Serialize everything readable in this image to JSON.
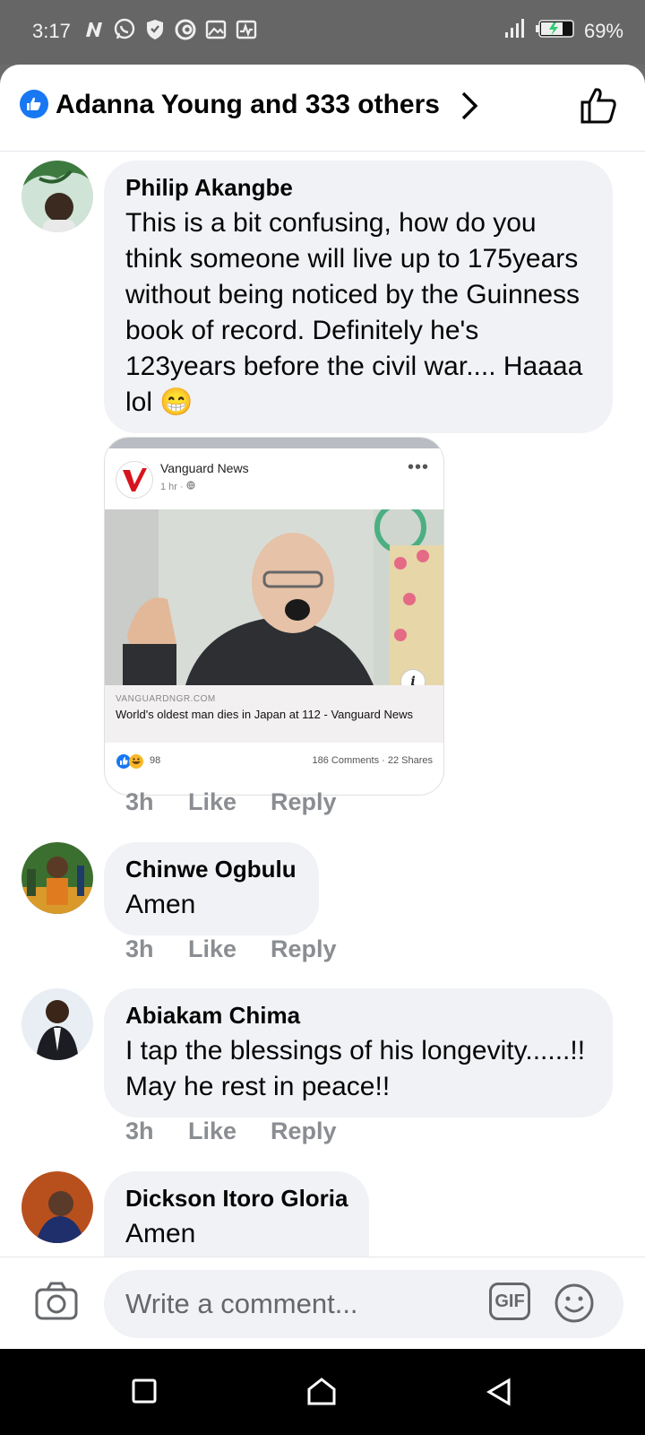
{
  "status_bar": {
    "time": "3:17",
    "battery_percent": "69%",
    "notification_icons": [
      "n-icon",
      "whatsapp-icon",
      "shield-icon",
      "opera-icon",
      "gallery-icon",
      "activity-icon"
    ]
  },
  "header": {
    "reactors_text": "Adanna Young and 333 others"
  },
  "comments": [
    {
      "author": "Philip Akangbe",
      "text": "This is a bit confusing, how do you think someone will live up to 175years without being noticed by the Guinness book of record. Definitely he's 123years before the civil war.... Haaaa lol 😁",
      "time": "3h",
      "like": "Like",
      "reply": "Reply"
    },
    {
      "author": "Chinwe Ogbulu",
      "text": "Amen",
      "time": "3h",
      "like": "Like",
      "reply": "Reply"
    },
    {
      "author": "Abiakam Chima",
      "text": "I tap the blessings of his longevity......!! May he rest in peace!!",
      "time": "3h",
      "like": "Like",
      "reply": "Reply"
    },
    {
      "author": "Dickson Itoro Gloria",
      "text": "Amen"
    }
  ],
  "shared_card": {
    "source": "Vanguard News",
    "meta": "1 hr ·",
    "domain": "VANGUARDNGR.COM",
    "title": "World's oldest man dies in Japan at 112 - Vanguard News",
    "reaction_count": "98",
    "stats": "186 Comments · 22 Shares"
  },
  "composer": {
    "placeholder": "Write a comment...",
    "gif_label": "GIF"
  },
  "colors": {
    "facebook_blue": "#1877f2",
    "bubble_bg": "#f0f2f5",
    "meta_gray": "#8a8d91"
  }
}
